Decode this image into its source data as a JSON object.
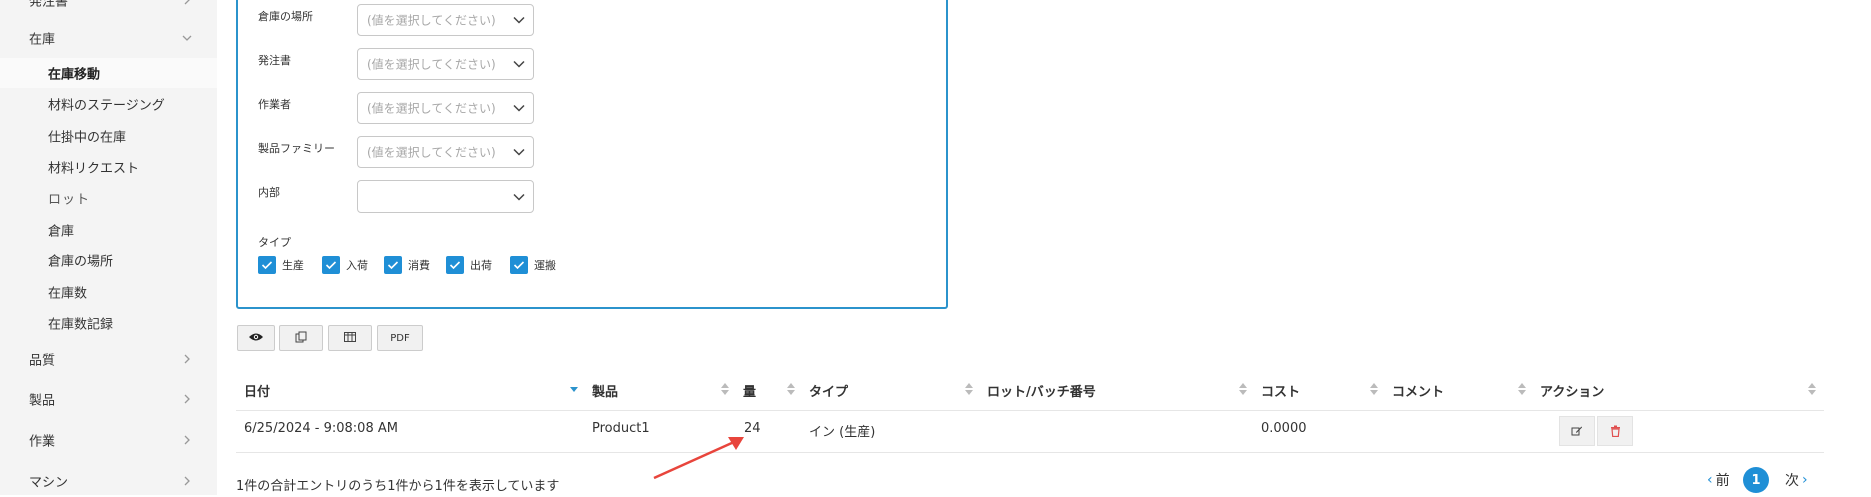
{
  "sidebar": {
    "top_partial_label": "発注書",
    "inventory_label": "在庫",
    "sub_items": [
      {
        "label": "在庫移動"
      },
      {
        "label": "材料のステージング"
      },
      {
        "label": "仕掛中の在庫"
      },
      {
        "label": "材料リクエスト"
      },
      {
        "label": "ロット"
      },
      {
        "label": "倉庫"
      },
      {
        "label": "倉庫の場所"
      },
      {
        "label": "在庫数"
      },
      {
        "label": "在庫数記録"
      }
    ],
    "sections": [
      {
        "label": "品質"
      },
      {
        "label": "製品"
      },
      {
        "label": "作業"
      },
      {
        "label": "マシン"
      }
    ]
  },
  "filters": {
    "fields": [
      {
        "label": "倉庫の場所",
        "placeholder": "(値を選択してください)"
      },
      {
        "label": "発注書",
        "placeholder": "(値を選択してください)"
      },
      {
        "label": "作業者",
        "placeholder": "(値を選択してください)"
      },
      {
        "label": "製品ファミリー",
        "placeholder": "(値を選択してください)"
      },
      {
        "label": "内部",
        "placeholder": ""
      }
    ],
    "type_label": "タイプ",
    "types": [
      {
        "label": "生産",
        "checked": true
      },
      {
        "label": "入荷",
        "checked": true
      },
      {
        "label": "消費",
        "checked": true
      },
      {
        "label": "出荷",
        "checked": true
      },
      {
        "label": "運搬",
        "checked": true
      }
    ]
  },
  "toolbar": {
    "buttons": [
      {
        "icon": "eye-icon"
      },
      {
        "icon": "copy-icon"
      },
      {
        "icon": "columns-icon"
      },
      {
        "label": "PDF"
      }
    ]
  },
  "table": {
    "columns": [
      "日付",
      "製品",
      "量",
      "タイプ",
      "ロット/バッチ番号",
      "コスト",
      "コメント",
      "アクション"
    ],
    "sorted_column": "日付",
    "rows": [
      {
        "date": "6/25/2024 - 9:08:08 AM",
        "product": "Product1",
        "quantity": "24",
        "type": "イン (生産)",
        "lot": "",
        "cost": "0.0000",
        "comment": ""
      }
    ]
  },
  "footer": {
    "info": "1件の合計エントリのうち1件から1件を表示しています",
    "prev": "前",
    "current_page": "1",
    "next": "次"
  },
  "annotation": {
    "type": "arrow",
    "color": "#e8453c",
    "points_to": "quantity-cell"
  },
  "colors": {
    "accent": "#1f8fd6",
    "panel_border": "#2b93cc",
    "delete": "#e05050"
  }
}
